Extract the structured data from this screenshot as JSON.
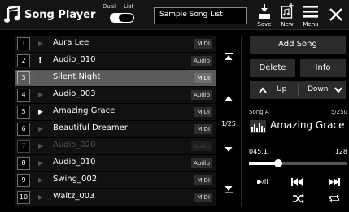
{
  "header": {
    "title": "Song Player",
    "dual_label": "Dual",
    "list_label": "List",
    "song_list_name": "Sample Song List",
    "save_label": "Save",
    "new_label": "New",
    "menu_label": "Menu"
  },
  "songs": [
    {
      "num": "1",
      "mark": "play",
      "name": "Aura Lee",
      "tag": "MIDI",
      "state": "normal"
    },
    {
      "num": "2",
      "mark": "excl",
      "name": "Audio_010",
      "tag": "Audio",
      "state": "normal"
    },
    {
      "num": "3",
      "mark": "play",
      "name": "Silent Night",
      "tag": "MIDI",
      "state": "selected"
    },
    {
      "num": "4",
      "mark": "play",
      "name": "Audio_003",
      "tag": "Audio",
      "state": "normal"
    },
    {
      "num": "5",
      "mark": "playing",
      "name": "Amazing Grace",
      "tag": "MIDI",
      "state": "normal"
    },
    {
      "num": "6",
      "mark": "play",
      "name": "Beautiful Dreamer",
      "tag": "MIDI",
      "state": "normal"
    },
    {
      "num": "7",
      "mark": "play",
      "name": "Audio_020",
      "tag": "Audio",
      "state": "disabled"
    },
    {
      "num": "8",
      "mark": "play",
      "name": "Audio_010",
      "tag": "Audio",
      "state": "normal"
    },
    {
      "num": "9",
      "mark": "play",
      "name": "Swing_002",
      "tag": "MIDI",
      "state": "normal"
    },
    {
      "num": "10",
      "mark": "play",
      "name": "Waltz_003",
      "tag": "MIDI",
      "state": "normal"
    }
  ],
  "scroll": {
    "page_indicator": "1/25"
  },
  "panel": {
    "add_song_label": "Add Song",
    "delete_label": "Delete",
    "info_label": "Info",
    "up_label": "Up",
    "down_label": "Down"
  },
  "now_playing": {
    "label": "Song A",
    "position": "5/250",
    "title": "Amazing Grace",
    "time": "045.1",
    "tempo": "128",
    "progress_fraction": 0.3,
    "play_pause_label": "▶/II"
  },
  "icons": {
    "app": "music-note-icon",
    "save": "save-icon",
    "new": "new-file-icon",
    "menu": "menu-icon",
    "close": "close-icon",
    "previous": "previous-icon",
    "next": "next-icon",
    "shuffle": "shuffle-icon",
    "repeat": "repeat-icon"
  }
}
